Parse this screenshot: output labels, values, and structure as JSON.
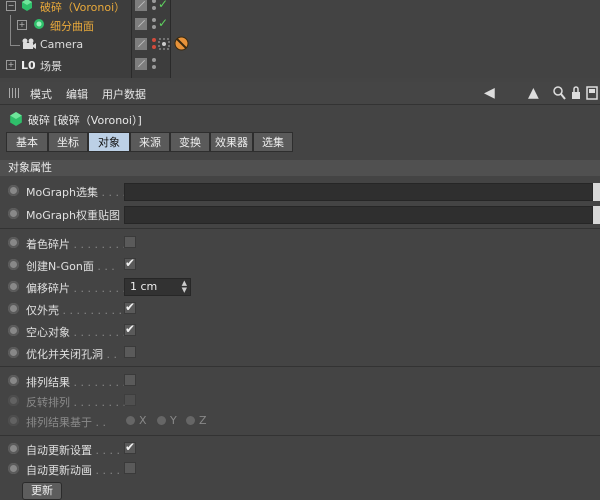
{
  "object_manager": {
    "rows": [
      {
        "label": "破碎（Voronoi）",
        "color": "#e9a93b"
      },
      {
        "label": "细分曲面",
        "color": "#e9a93b"
      },
      {
        "label": "Camera",
        "color": "#dddddd"
      },
      {
        "label": "场景",
        "color": "#dddddd"
      }
    ]
  },
  "toolbar": {
    "menus": [
      "模式",
      "编辑",
      "用户数据"
    ]
  },
  "attributes": {
    "title": "破碎 [破碎（Voronoi）]",
    "tabs": [
      "基本",
      "坐标",
      "对象",
      "来源",
      "变换",
      "效果器",
      "选集"
    ],
    "active_tab": "对象",
    "section": "对象属性"
  },
  "params": {
    "mograph_selection": "MoGraph选集",
    "mograph_weight": "MoGraph权重贴图",
    "color_fragments": "着色碎片",
    "create_ngon": "创建N-Gon面",
    "offset_fragments": "偏移碎片",
    "offset_value": "1 cm",
    "shell_only": "仅外壳",
    "hollow": "空心对象",
    "optimize_close": "优化并关闭孔洞",
    "sort_results": "排列结果",
    "invert_sort": "反转排列",
    "sort_based_on": "排列结果基于",
    "axis_x": "X",
    "axis_y": "Y",
    "axis_z": "Z",
    "auto_update": "自动更新设置",
    "auto_update_anim": "自动更新动画",
    "update_button": "更新"
  },
  "checkbox_states": {
    "color_fragments": false,
    "create_ngon": true,
    "shell_only": true,
    "hollow": true,
    "optimize_close": false,
    "sort_results": false,
    "invert_sort": false,
    "auto_update": true,
    "auto_update_anim": false
  },
  "colors": {
    "panel_bg": "#444444",
    "active_tab": "#bcd0e6",
    "object_name": "#e9a93b",
    "check_green": "#5fd35f"
  }
}
